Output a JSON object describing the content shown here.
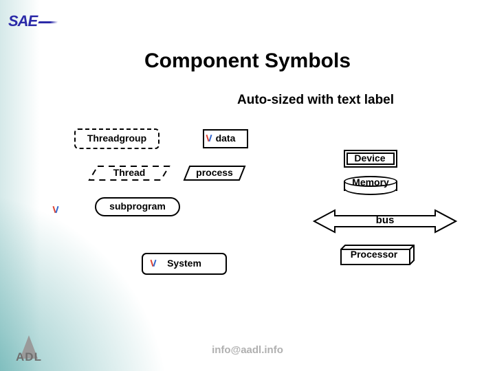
{
  "title": "Component Symbols",
  "subtitle": "Auto-sized with text label",
  "footer_email": "info@aadl.info",
  "logo_sae": "SAE",
  "logo_adl": "ADL",
  "symbols": {
    "threadgroup": "Threadgroup",
    "data": "data",
    "thread": "Thread",
    "process": "process",
    "subprogram": "subprogram",
    "system": "System",
    "device": "Device",
    "memory": "Memory",
    "bus": "bus",
    "processor": "Processor"
  }
}
